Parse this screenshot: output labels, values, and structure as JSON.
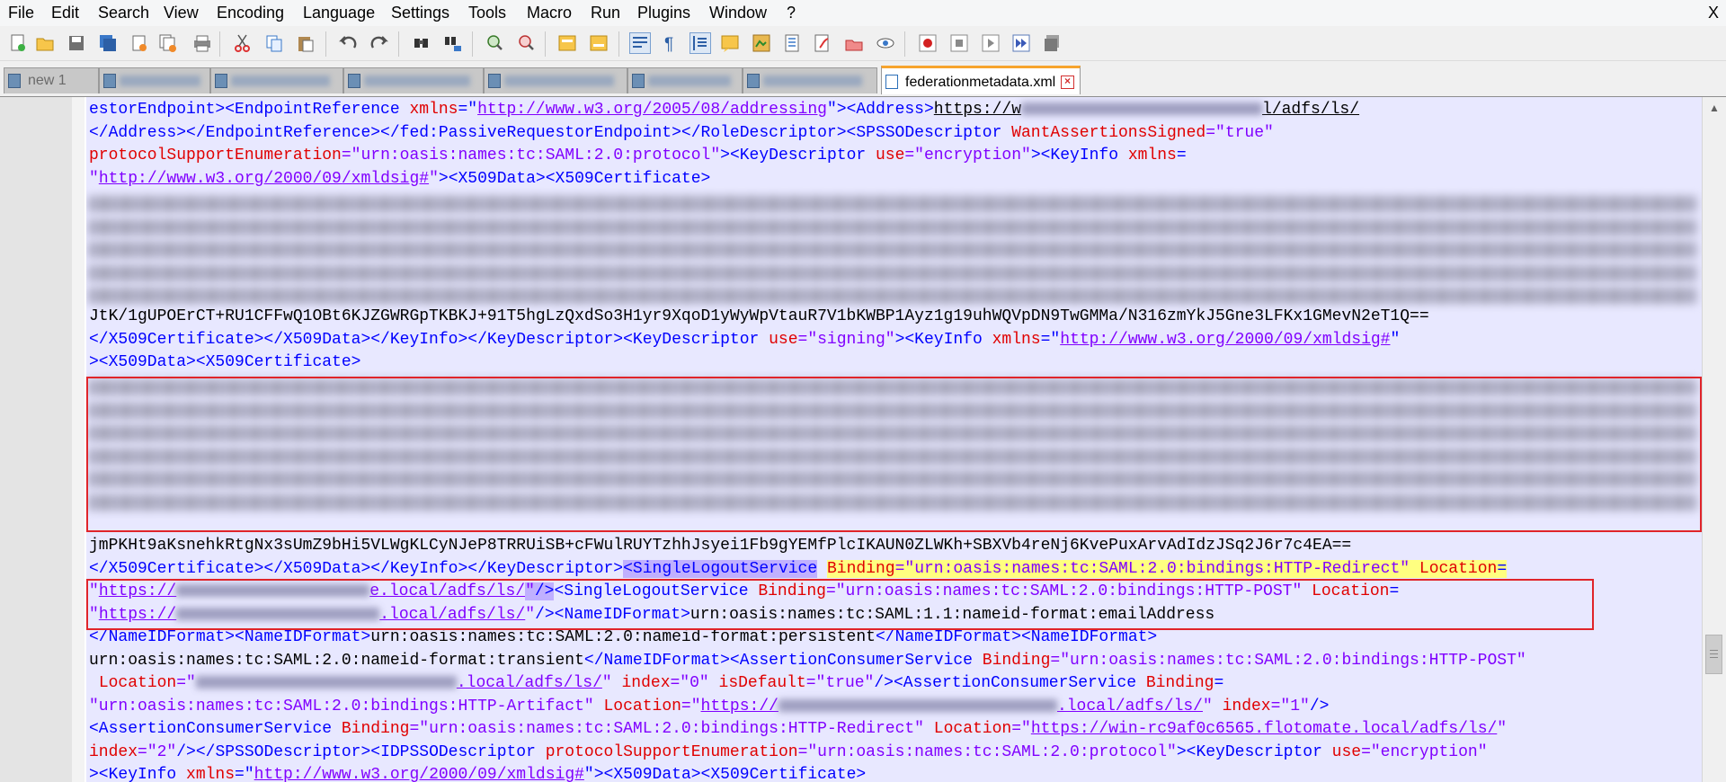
{
  "window": {
    "close_label": "X"
  },
  "menu": [
    "File",
    "Edit",
    "Search",
    "View",
    "Encoding",
    "Language",
    "Settings",
    "Tools",
    "Macro",
    "Run",
    "Plugins",
    "Window",
    "?"
  ],
  "toolbar": {
    "buttons": [
      "new-file-icon",
      "open-file-icon",
      "save-icon",
      "save-all-icon",
      "close-icon",
      "close-all-icon",
      "print-icon",
      "cut-icon",
      "copy-icon",
      "paste-icon",
      "undo-icon",
      "redo-icon",
      "find-icon",
      "replace-icon",
      "zoom-in-icon",
      "zoom-out-icon",
      "sync-vertical-icon",
      "sync-horizontal-icon",
      "word-wrap-icon",
      "show-all-characters-icon",
      "indent-guide-icon",
      "user-language-icon",
      "document-map-icon",
      "function-list-icon",
      "folder-as-workspace-icon",
      "monitoring-icon",
      "record-macro-icon",
      "stop-macro-icon",
      "play-macro-icon",
      "run-macro-multiple-icon",
      "save-macro-icon"
    ]
  },
  "tabs": {
    "first": {
      "label": "new 1"
    },
    "active": {
      "label": "federationmetadata.xml"
    }
  },
  "colors": {
    "tag": "#0000ff",
    "attribute": "#e00000",
    "value": "#8000ff",
    "selection": "#c0b0ff",
    "highlight_box": "#e0242a",
    "tab_accent": "#f7a42d"
  },
  "code": {
    "l1": {
      "a": "estorEndpoint><EndpointReference ",
      "b": "xmlns",
      "c": "=\"",
      "d": "http://www.w3.org/2005/08/addressing",
      "e": "\"><Address>",
      "f": "https://w",
      "g": "l/adfs/ls/"
    },
    "l2": {
      "a": "</Address></EndpointReference></fed:PassiveRequestorEndpoint></RoleDescriptor><SPSSODescriptor ",
      "b": "WantAssertionsSigned",
      "c": "=\"true\""
    },
    "l3": {
      "a": "protocolSupportEnumeration",
      "b": "=\"urn:oasis:names:tc:SAML:2.0:protocol\"",
      "c": "><KeyDescriptor ",
      "d": "use",
      "e": "=\"encryption\"",
      "f": "><KeyInfo ",
      "g": "xmlns",
      "h": "="
    },
    "l4": {
      "a": "\"",
      "b": "http://www.w3.org/2000/09/xmldsig#",
      "c": "\"",
      "d": "><X509Data><X509Certificate>"
    },
    "l10": "JtK/1gUPOErCT+RU1CFFwQ1OBt6KJZGWRGpTKBKJ+91T5hgLzQxdSo3H1yr9XqoD1yWyWpVtauR7V1bKWBP1Ayz1g19uhWQVpDN9TwGMMa/N316zmYkJ5Gne3LFKx1GMevN2eT1Q==",
    "l11": {
      "a": "</X509Certificate></X509Data></KeyInfo></KeyDescriptor><KeyDescriptor ",
      "b": "use",
      "c": "=\"signing\"",
      "d": "><KeyInfo ",
      "e": "xmlns",
      "f": "=\"",
      "g": "http://www.w3.org/2000/09/xmldsig#",
      "h": "\""
    },
    "l12": "><X509Data><X509Certificate>",
    "l19": "jmPKHt9aKsnehkRtgNx3sUmZ9bHi5VLWgKLCyNJeP8TRRUiSB+cFWulRUYTzhhJsyei1Fb9gYEMfPlcIKAUN0ZLWKh+SBXVb4reNj6KvePuxArvAdIdzJSq2J6r7c4EA==",
    "l20": {
      "a": "</X509Certificate></X509Data></KeyInfo></KeyDescriptor>",
      "b": "<SingleLogoutService",
      "c": " ",
      "d": "Binding",
      "e": "=\"urn:oasis:names:tc:SAML:2.0:bindings:HTTP-Redirect\"",
      "f": " ",
      "g": "Location",
      "h": "="
    },
    "l21": {
      "a": "\"",
      "b": "https://",
      "c": "e.local/adfs/ls/",
      "d": "\"",
      "e": "/>",
      "f": "<SingleLogoutService ",
      "g": "Binding",
      "h": "=\"urn:oasis:names:tc:SAML:2.0:bindings:HTTP-POST\"",
      "i": " ",
      "j": "Location",
      "k": "="
    },
    "l22": {
      "a": "\"",
      "b": "https://",
      "c": ".local/adfs/ls/",
      "d": "\"",
      "e": "/><NameIDFormat>",
      "f": "urn:oasis:names:tc:SAML:1.1:nameid-format:emailAddress"
    },
    "l23": {
      "a": "</NameIDFormat><NameIDFormat>",
      "b": "urn:oasis:names:tc:SAML:2.0:nameid-format:persistent",
      "c": "</NameIDFormat><NameIDFormat>"
    },
    "l24": {
      "a": "urn:oasis:names:tc:SAML:2.0:nameid-format:transient",
      "b": "</NameIDFormat><AssertionConsumerService ",
      "c": "Binding",
      "d": "=\"urn:oasis:names:tc:SAML:2.0:bindings:HTTP-POST\""
    },
    "l25": {
      "a": " ",
      "b": "Location",
      "c": "=\"",
      "d": ".local/adfs/ls/",
      "e": "\"",
      "f": " index",
      "g": "=\"0\"",
      "h": " isDefault",
      "i": "=\"true\"",
      "j": "/><AssertionConsumerService ",
      "k": "Binding",
      "l": "="
    },
    "l26": {
      "a": "\"urn:oasis:names:tc:SAML:2.0:bindings:HTTP-Artifact\"",
      "b": " Location",
      "c": "=\"",
      "d": "https://",
      "e": ".local/adfs/ls/",
      "f": "\"",
      "g": " index",
      "h": "=\"1\"",
      "i": "/>"
    },
    "l27": {
      "a": "<AssertionConsumerService ",
      "b": "Binding",
      "c": "=\"urn:oasis:names:tc:SAML:2.0:bindings:HTTP-Redirect\"",
      "d": " Location",
      "e": "=\"",
      "f": "https://win-rc9af0c6565.flotomate.local/adfs/ls/",
      "g": "\""
    },
    "l28": {
      "a": "index",
      "b": "=\"2\"",
      "c": "/></SPSSODescriptor><IDPSSODescriptor ",
      "d": "protocolSupportEnumeration",
      "e": "=\"urn:oasis:names:tc:SAML:2.0:protocol\"",
      "f": "><KeyDescriptor ",
      "g": "use",
      "h": "=\"encryption\""
    },
    "l29": {
      "a": "><KeyInfo ",
      "b": "xmlns",
      "c": "=\"",
      "d": "http://www.w3.org/2000/09/xmldsig#",
      "e": "\"",
      "f": "><X509Data><X509Certificate>"
    }
  }
}
